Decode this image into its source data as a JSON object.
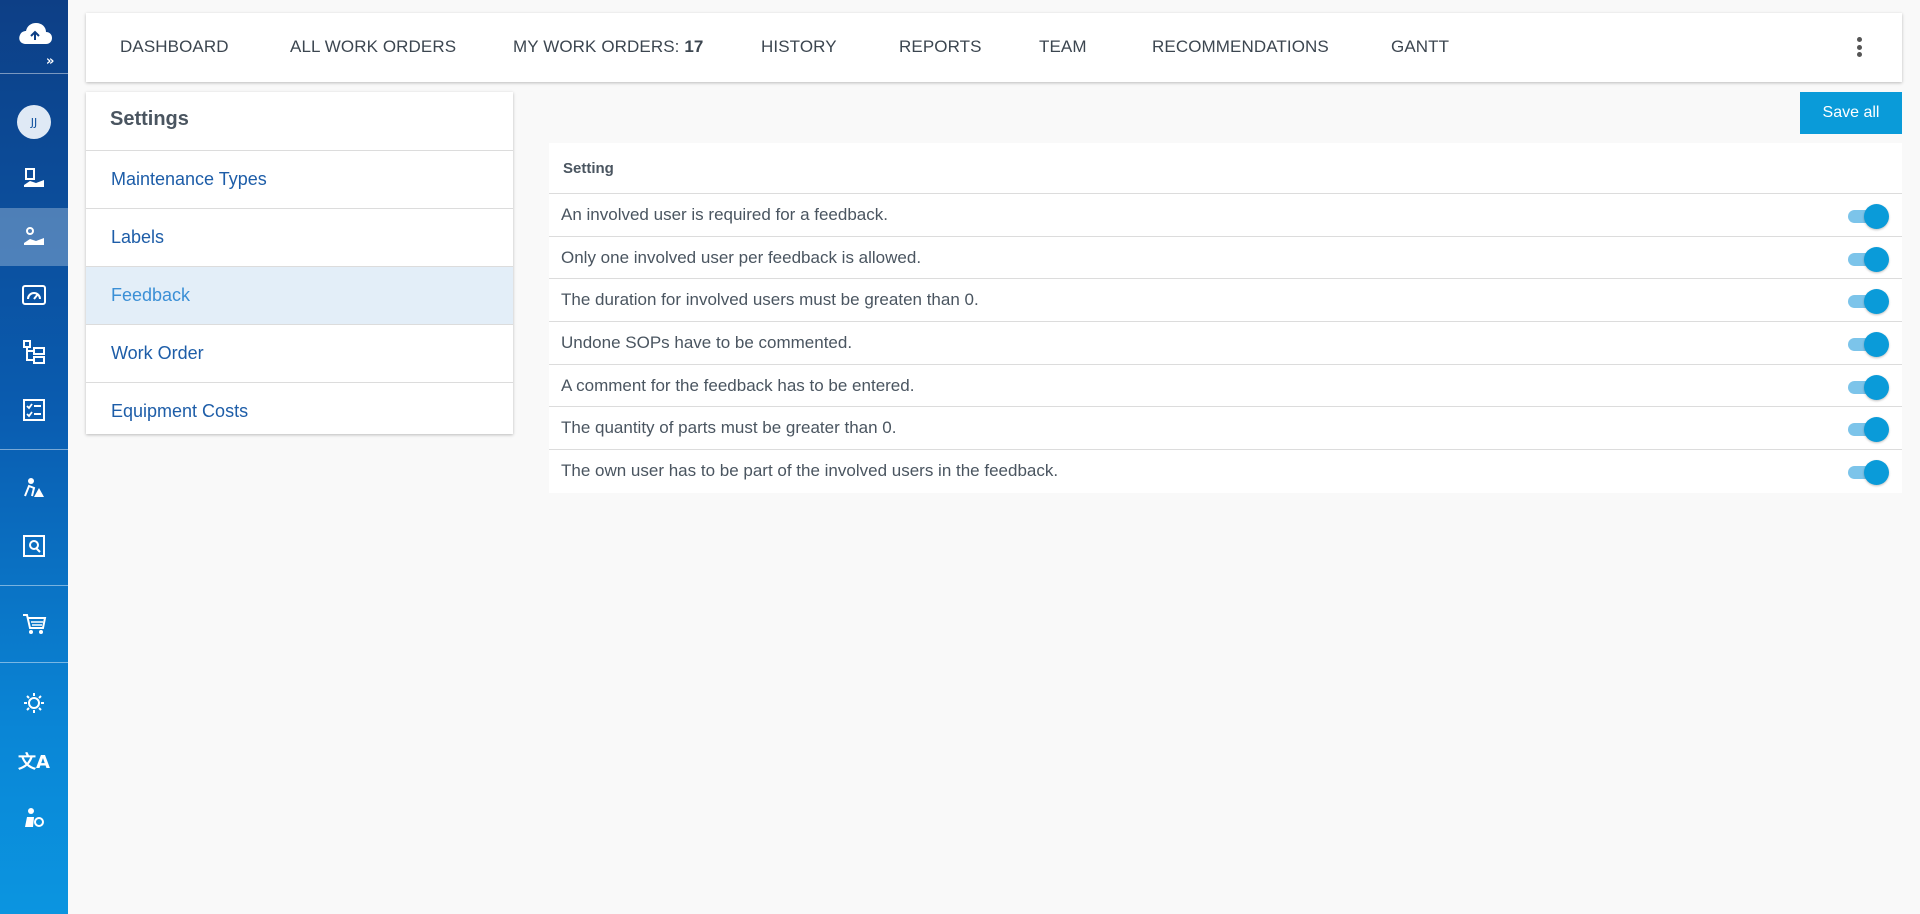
{
  "sidebar": {
    "avatar_initials": "JJ",
    "icons": [
      "cloud-logo-icon",
      "expand-icon",
      "work-order-icon",
      "feedback-hand-icon",
      "dashboard-gauge-icon",
      "hierarchy-icon",
      "checklist-icon",
      "user-warning-icon",
      "image-settings-icon",
      "cart-icon",
      "brightness-icon",
      "translate-icon",
      "user-settings-icon"
    ]
  },
  "topnav": {
    "tabs": [
      {
        "label": "DASHBOARD"
      },
      {
        "label": "ALL WORK ORDERS"
      },
      {
        "label": "MY WORK ORDERS:",
        "count": "17"
      },
      {
        "label": "HISTORY"
      },
      {
        "label": "REPORTS"
      },
      {
        "label": "TEAM"
      },
      {
        "label": "RECOMMENDATIONS"
      },
      {
        "label": "GANTT"
      }
    ]
  },
  "settings": {
    "title": "Settings",
    "menu": [
      {
        "label": "Maintenance Types",
        "active": false
      },
      {
        "label": "Labels",
        "active": false
      },
      {
        "label": "Feedback",
        "active": true
      },
      {
        "label": "Work Order",
        "active": false
      },
      {
        "label": "Equipment Costs",
        "active": false
      }
    ]
  },
  "actions": {
    "save_all_label": "Save all"
  },
  "table": {
    "header": "Setting",
    "rows": [
      {
        "text": "An involved user is required for a feedback.",
        "enabled": true
      },
      {
        "text": "Only one involved user per feedback is allowed.",
        "enabled": true
      },
      {
        "text": "The duration for involved users must be greaten than 0.",
        "enabled": true
      },
      {
        "text": "Undone SOPs have to be commented.",
        "enabled": true
      },
      {
        "text": "A comment for the feedback has to be entered.",
        "enabled": true
      },
      {
        "text": "The quantity of parts must be greater than 0.",
        "enabled": true
      },
      {
        "text": "The own user has to be part of the involved users in the feedback.",
        "enabled": true
      }
    ]
  },
  "colors": {
    "accent": "#0a9bd9",
    "link": "#1d5da8",
    "sidebar_top": "#0d3f86",
    "sidebar_bottom": "#0b95e0"
  }
}
